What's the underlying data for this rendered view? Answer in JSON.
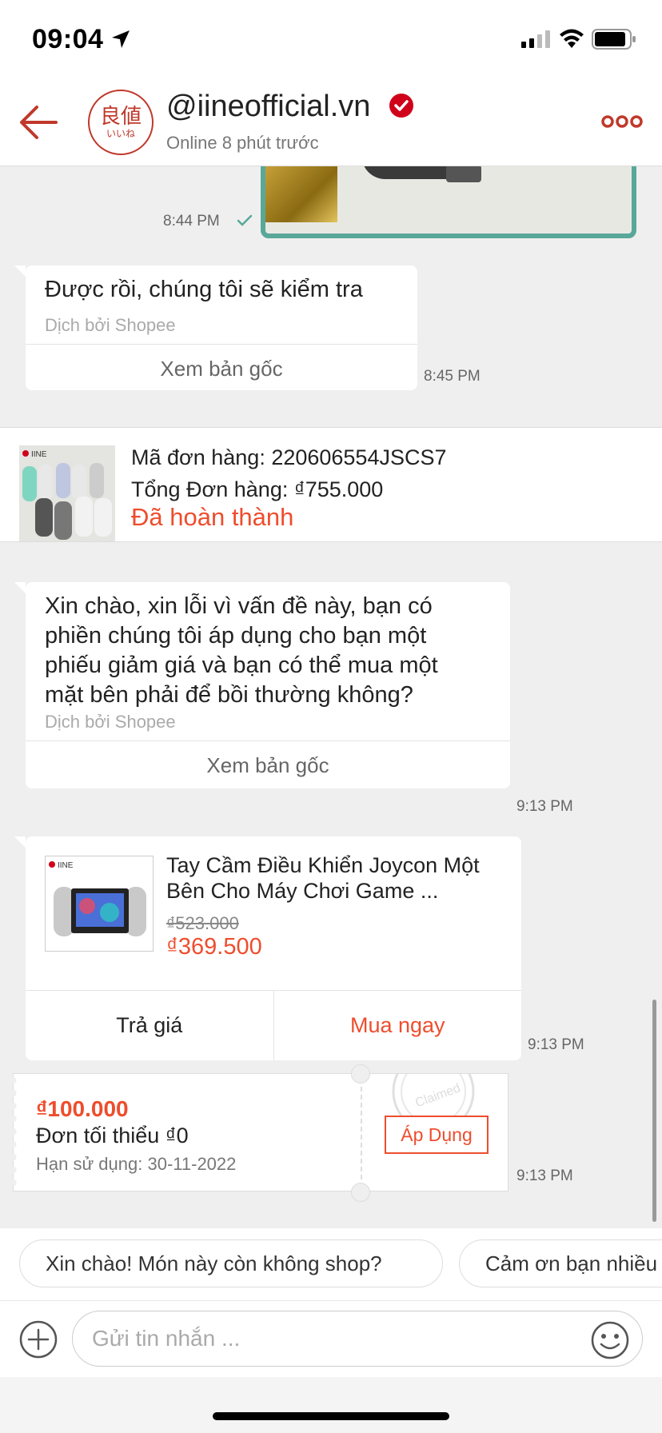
{
  "status_bar": {
    "time": "09:04"
  },
  "header": {
    "avatar_kanji": "良値",
    "avatar_kana": "いいね",
    "shop_name": "@iineofficial.vn",
    "online_status": "Online 8 phút trước"
  },
  "messages": {
    "image_time": "8:44 PM",
    "msg1": {
      "text": "Được rồi, chúng tôi sẽ kiểm tra",
      "translated": "Dịch bởi Shopee",
      "view_original": "Xem bản gốc",
      "time": "8:45 PM"
    },
    "order": {
      "code": "Mã đơn hàng: 220606554JSCS7",
      "total": "Tổng Đơn hàng: ₫755.000",
      "status": "Đã hoàn thành",
      "thumb_brand": "IINE"
    },
    "msg2": {
      "lines": [
        "Xin chào, xin lỗi vì vấn đề này, bạn có",
        "phiền chúng tôi áp dụng cho bạn một",
        "phiếu giảm giá và bạn có thể mua một",
        "mặt bên phải để bồi thường không?"
      ],
      "translated": "Dịch bởi Shopee",
      "view_original": "Xem bản gốc",
      "time": "9:13 PM"
    },
    "product": {
      "brand": "IINE",
      "title": "Tay Cầm Điều Khiển Joycon Một Bên Cho Máy Chơi Game ...",
      "old_price": "₫523.000",
      "new_price": "₫369.500",
      "bargain_label": "Trả giá",
      "buy_label": "Mua ngay",
      "time": "9:13 PM"
    },
    "voucher": {
      "amount": "₫100.000",
      "min_order": "Đơn tối thiểu ₫0",
      "expiry": "Hạn sử dụng: 30-11-2022",
      "stamp_text": "Claimed",
      "apply_label": "Áp Dụng",
      "time": "9:13 PM"
    }
  },
  "quick_replies": [
    "Xin chào! Món này còn không shop?",
    "Cảm ơn bạn nhiều"
  ],
  "input": {
    "placeholder": "Gửi tin nhắn ..."
  },
  "colors": {
    "accent": "#ee4d2d",
    "brand_red": "#c0392b",
    "verified": "#d0011b",
    "image_border": "#58a89a"
  },
  "icons": [
    "location-arrow-icon",
    "signal-icon",
    "wifi-icon",
    "battery-icon",
    "back-arrow-icon",
    "verified-icon",
    "more-icon",
    "check-icon",
    "plus-icon",
    "emoji-icon"
  ]
}
